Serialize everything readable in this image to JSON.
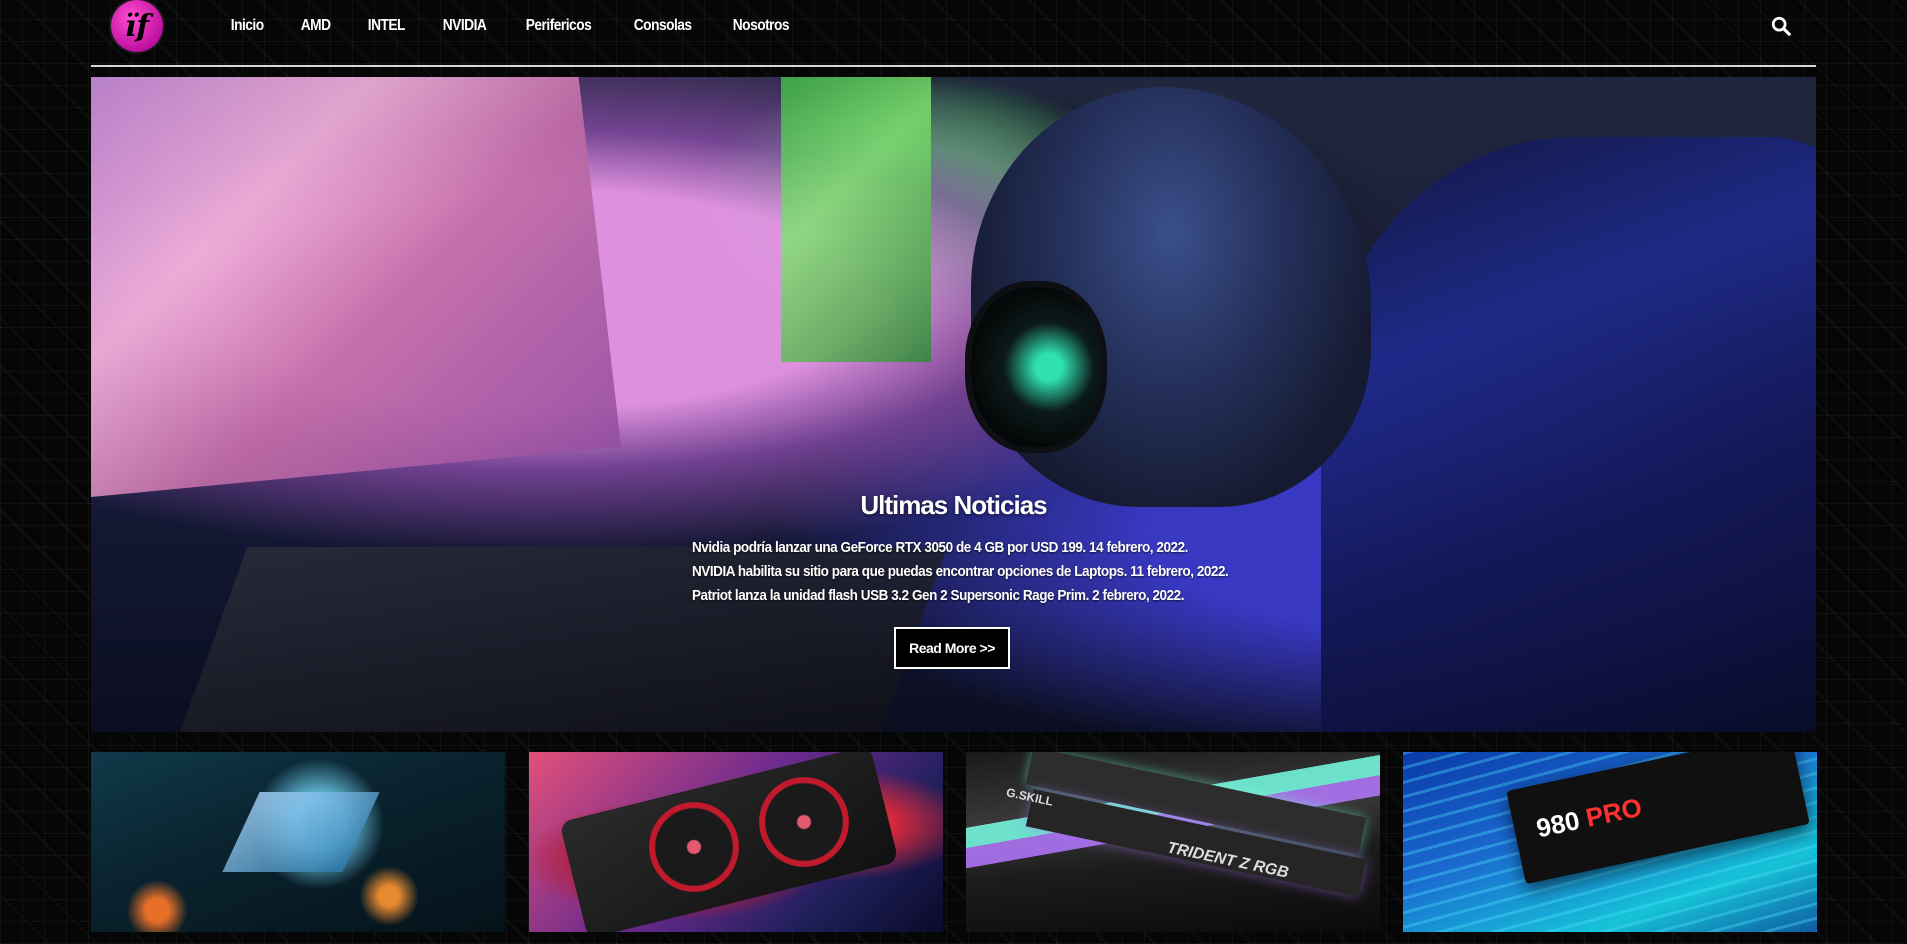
{
  "logo": {
    "mark": "ïf"
  },
  "nav": {
    "items": [
      {
        "label": "Inicio"
      },
      {
        "label": "AMD"
      },
      {
        "label": "INTEL"
      },
      {
        "label": "NVIDIA"
      },
      {
        "label": "Perifericos"
      },
      {
        "label": "Consolas"
      },
      {
        "label": "Nosotros"
      }
    ],
    "search_icon": "search-icon"
  },
  "hero": {
    "title": "Ultimas Noticias",
    "news": [
      "Nvidia podría lanzar una GeForce RTX 3050 de 4 GB por USD 199. 14 febrero, 2022.",
      "NVIDIA habilita su sitio para que puedas encontrar opciones de Laptops. 11 febrero, 2022.",
      "Patriot lanza la unidad flash USB 3.2 Gen 2 Supersonic Rage Prim. 2 febrero, 2022."
    ],
    "button_label": "Read More >>"
  },
  "thumbnails": {
    "ram_brand": "G.SKILL",
    "ram_label": "TRIDENT Z RGB",
    "ssd_brand": "980",
    "ssd_accent": "PRO"
  },
  "colors": {
    "background": "#060606",
    "logo": "#c010a0",
    "divider": "#d8d8d8",
    "button_bg": "#000000",
    "button_border": "#ffffff"
  }
}
